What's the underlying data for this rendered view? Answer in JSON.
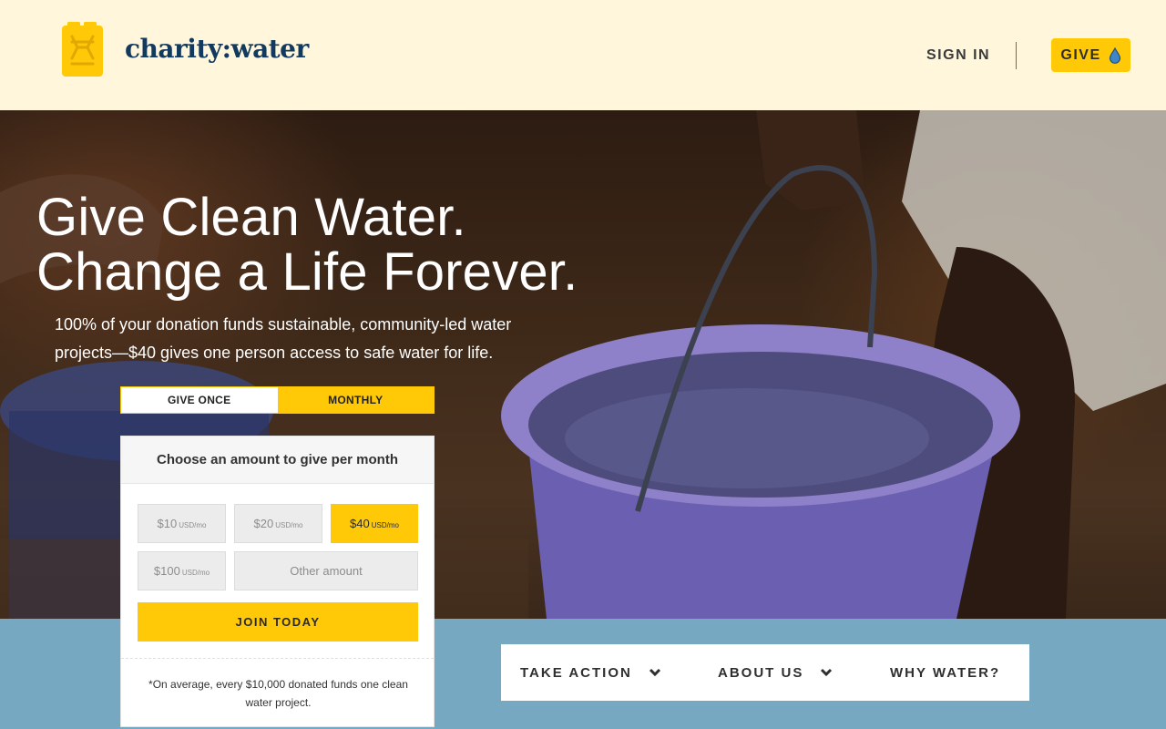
{
  "header": {
    "brand": "charity:water",
    "sign_in": "SIGN IN",
    "give": "GIVE",
    "brand_color": "#12395e",
    "accent": "#ffc907"
  },
  "hero": {
    "headline_1": "Give Clean Water.",
    "headline_2": "Change a Life Forever.",
    "subtext": "100% of your donation funds sustainable, community-led water projects—$40 gives one person access to safe water for life."
  },
  "donate": {
    "tabs": [
      {
        "label": "GIVE ONCE",
        "selected": false
      },
      {
        "label": "MONTHLY",
        "selected": true
      }
    ],
    "heading": "Choose an amount to give per month",
    "amounts": [
      {
        "value": "$10",
        "unit": "USD/mo",
        "selected": false
      },
      {
        "value": "$20",
        "unit": "USD/mo",
        "selected": false
      },
      {
        "value": "$40",
        "unit": "USD/mo",
        "selected": true
      },
      {
        "value": "$100",
        "unit": "USD/mo",
        "selected": false
      }
    ],
    "other_placeholder": "Other amount",
    "cta": "JOIN TODAY",
    "note": "*On average, every $10,000 donated funds one clean water project."
  },
  "menu": {
    "items": [
      {
        "label": "TAKE ACTION",
        "icon": "chevron-down-icon"
      },
      {
        "label": "ABOUT US",
        "icon": "chevron-down-icon"
      },
      {
        "label": "WHY WATER?"
      }
    ]
  },
  "colors": {
    "background": "#fff6dc",
    "band": "#77a8c1",
    "bucket": "#8e80c9"
  }
}
